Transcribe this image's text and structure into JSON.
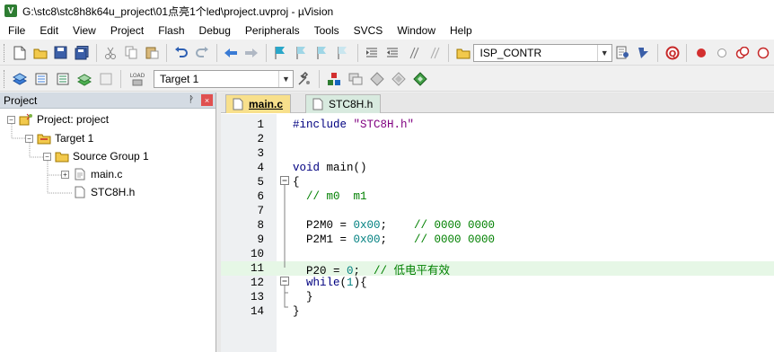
{
  "window": {
    "title": "G:\\stc8\\stc8h8k64u_project\\01点亮1个led\\project.uvproj - µVision",
    "icon_label": "V"
  },
  "menu": [
    "File",
    "Edit",
    "View",
    "Project",
    "Flash",
    "Debug",
    "Peripherals",
    "Tools",
    "SVCS",
    "Window",
    "Help"
  ],
  "toolbar": {
    "isp_combo": "ISP_CONTR",
    "target_combo": "Target 1",
    "load_label": "LOAD"
  },
  "project_panel": {
    "title": "Project",
    "pin": "ᚹ",
    "close": "×",
    "tree": [
      {
        "label": "Project: project",
        "toggle": "−",
        "icon": "project-icon"
      },
      {
        "label": "Target 1",
        "toggle": "−",
        "icon": "target-folder-icon"
      },
      {
        "label": "Source Group 1",
        "toggle": "−",
        "icon": "folder-icon"
      },
      {
        "label": "main.c",
        "toggle": "+",
        "icon": "c-file-icon"
      },
      {
        "label": "STC8H.h",
        "toggle": "",
        "icon": "h-file-icon"
      }
    ]
  },
  "editor": {
    "tabs": [
      {
        "label": "main.c",
        "active": true
      },
      {
        "label": "STC8H.h",
        "active": false
      }
    ],
    "lines": [
      {
        "n": "1",
        "text": "#include \"STC8H.h\""
      },
      {
        "n": "2",
        "text": ""
      },
      {
        "n": "3",
        "text": ""
      },
      {
        "n": "4",
        "text": "void main()"
      },
      {
        "n": "5",
        "text": "{"
      },
      {
        "n": "6",
        "text": "  // m0  m1"
      },
      {
        "n": "7",
        "text": ""
      },
      {
        "n": "8",
        "text": "  P2M0 = 0x00;    // 0000 0000"
      },
      {
        "n": "9",
        "text": "  P2M1 = 0x00;    // 0000 0000"
      },
      {
        "n": "10",
        "text": ""
      },
      {
        "n": "11",
        "text": "  P20 = 0;  // 低电平有效"
      },
      {
        "n": "12",
        "text": "  while(1){"
      },
      {
        "n": "13",
        "text": "  }"
      },
      {
        "n": "14",
        "text": "}"
      }
    ],
    "highlighted_line": "11"
  },
  "colors": {
    "keyword": "#000080",
    "string": "#800080",
    "number": "#008080",
    "comment": "#008000",
    "active_tab": "#f8e08c",
    "current_line": "#e6f7e6"
  }
}
